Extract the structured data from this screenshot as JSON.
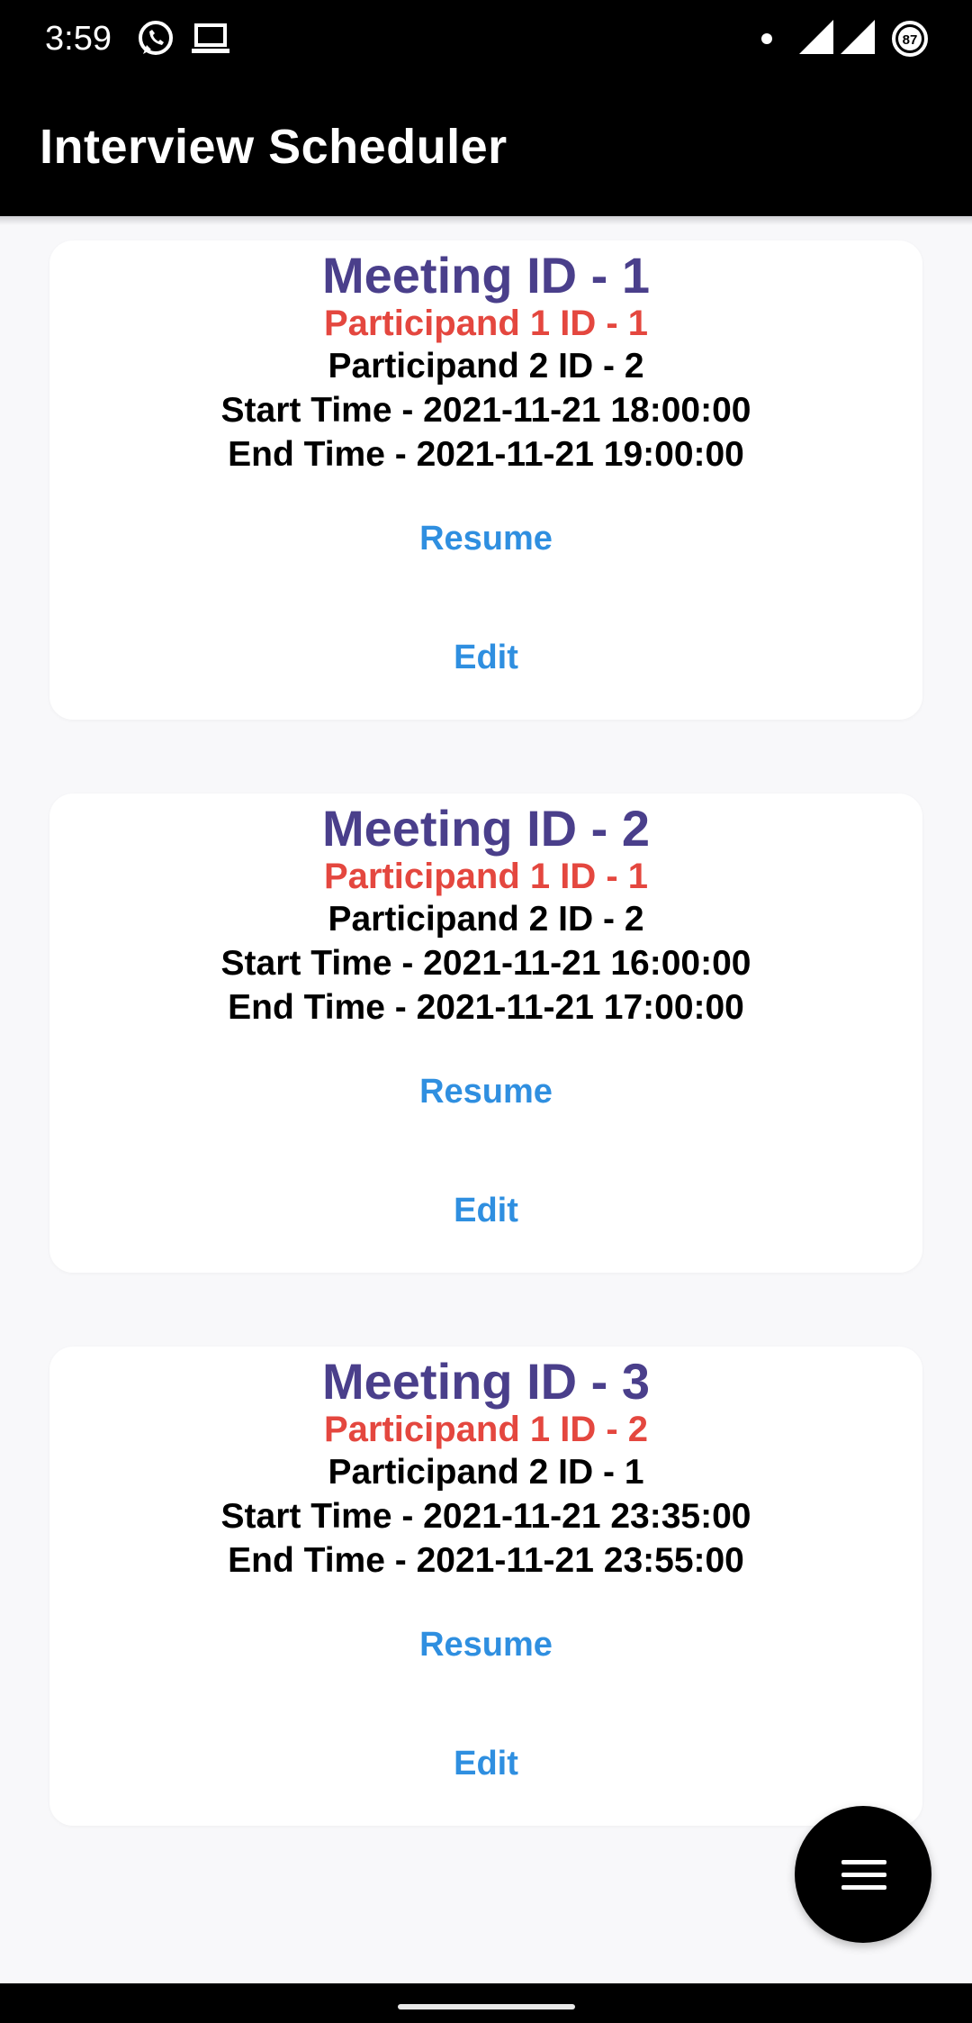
{
  "status_bar": {
    "time": "3:59",
    "battery": "87",
    "icons": [
      "whatsapp-icon",
      "laptop-icon",
      "dot-icon",
      "signal-icon",
      "signal-icon",
      "battery-icon"
    ]
  },
  "app_bar": {
    "title": "Interview Scheduler"
  },
  "meetings": [
    {
      "title": "Meeting ID - 1",
      "participant1": "Participand 1 ID - 1",
      "participant2": "Participand 2 ID - 2",
      "start": "Start Time - 2021-11-21 18:00:00",
      "end": "End Time - 2021-11-21 19:00:00",
      "resume_label": "Resume",
      "edit_label": "Edit"
    },
    {
      "title": "Meeting ID - 2",
      "participant1": "Participand 1 ID - 1",
      "participant2": "Participand 2 ID - 2",
      "start": "Start Time - 2021-11-21 16:00:00",
      "end": "End Time - 2021-11-21 17:00:00",
      "resume_label": "Resume",
      "edit_label": "Edit"
    },
    {
      "title": "Meeting ID - 3",
      "participant1": "Participand 1 ID - 2",
      "participant2": "Participand 2 ID - 1",
      "start": "Start Time - 2021-11-21 23:35:00",
      "end": "End Time - 2021-11-21 23:55:00",
      "resume_label": "Resume",
      "edit_label": "Edit"
    }
  ],
  "fab": {
    "icon": "menu-icon"
  },
  "colors": {
    "title": "#4a3f8b",
    "participant1": "#e4473f",
    "link": "#2f8fe0",
    "app_bar": "#000000"
  }
}
